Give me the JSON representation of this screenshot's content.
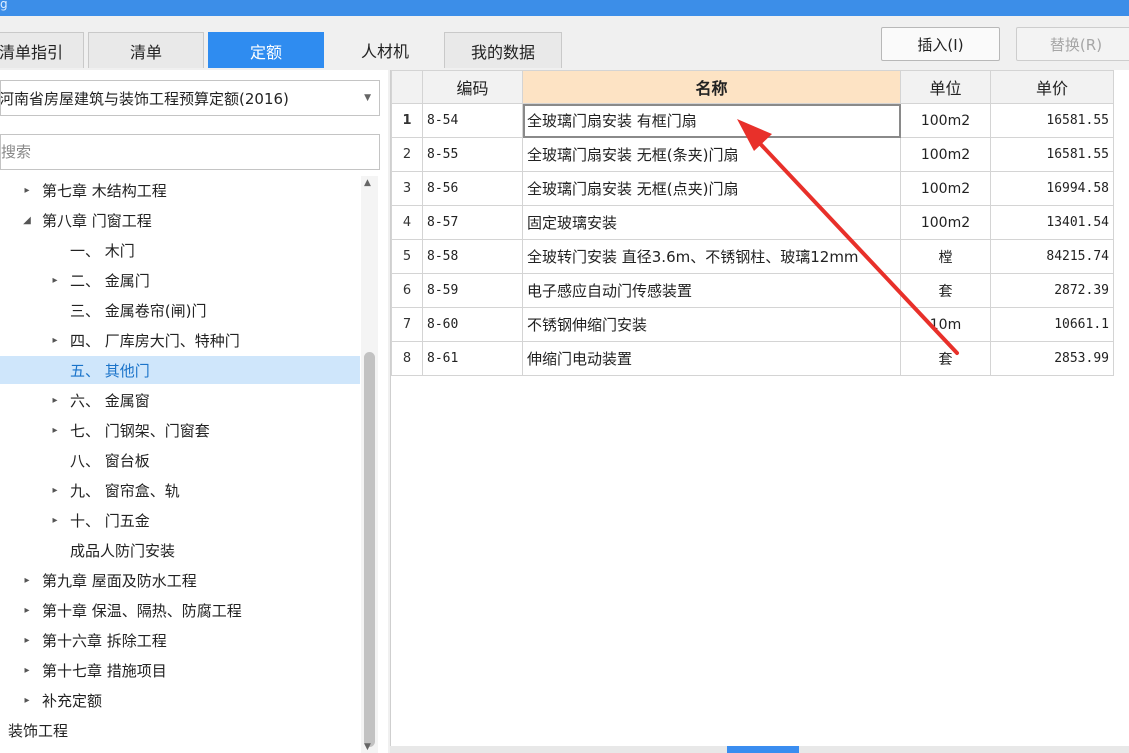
{
  "window": {
    "title_fragment": "g"
  },
  "tabs": [
    {
      "label": "清单指引",
      "active": false
    },
    {
      "label": "清单",
      "active": false
    },
    {
      "label": "定额",
      "active": true
    },
    {
      "label": "人材机",
      "active": false
    },
    {
      "label": "我的数据",
      "active": false
    }
  ],
  "toolbar": {
    "insert_label": "插入(I)",
    "replace_label": "替换(R)"
  },
  "left": {
    "quota_library": "河南省房屋建筑与装饰工程预算定额(2016)",
    "search_placeholder": "搜索",
    "tree": [
      {
        "label": "第七章 木结构工程",
        "toggle": "▸",
        "level": 1
      },
      {
        "label": "第八章 门窗工程",
        "toggle": "◢",
        "level": 1
      },
      {
        "label": "一、 木门",
        "toggle": "",
        "level": 2
      },
      {
        "label": "二、 金属门",
        "toggle": "▸",
        "level": 2
      },
      {
        "label": "三、 金属卷帘(闸)门",
        "toggle": "",
        "level": 2
      },
      {
        "label": "四、 厂库房大门、特种门",
        "toggle": "▸",
        "level": 2
      },
      {
        "label": "五、 其他门",
        "toggle": "",
        "level": 2,
        "selected": true
      },
      {
        "label": "六、 金属窗",
        "toggle": "▸",
        "level": 2
      },
      {
        "label": "七、 门钢架、门窗套",
        "toggle": "▸",
        "level": 2
      },
      {
        "label": "八、 窗台板",
        "toggle": "",
        "level": 2
      },
      {
        "label": "九、 窗帘盒、轨",
        "toggle": "▸",
        "level": 2
      },
      {
        "label": "十、 门五金",
        "toggle": "▸",
        "level": 2
      },
      {
        "label": "成品人防门安装",
        "toggle": "",
        "level": 2
      },
      {
        "label": "第九章 屋面及防水工程",
        "toggle": "▸",
        "level": 1
      },
      {
        "label": "第十章 保温、隔热、防腐工程",
        "toggle": "▸",
        "level": 1
      },
      {
        "label": "第十六章 拆除工程",
        "toggle": "▸",
        "level": 1
      },
      {
        "label": "第十七章 措施项目",
        "toggle": "▸",
        "level": 1
      },
      {
        "label": "补充定额",
        "toggle": "▸",
        "level": 1
      },
      {
        "label": "装饰工程",
        "toggle": "",
        "level": 0
      }
    ]
  },
  "grid": {
    "headers": {
      "code": "编码",
      "name": "名称",
      "unit": "单位",
      "price": "单价"
    },
    "rows": [
      {
        "num": "1",
        "code": "8-54",
        "name": "全玻璃门扇安装 有框门扇",
        "unit": "100m2",
        "price": "16581.55"
      },
      {
        "num": "2",
        "code": "8-55",
        "name": "全玻璃门扇安装 无框(条夹)门扇",
        "unit": "100m2",
        "price": "16581.55"
      },
      {
        "num": "3",
        "code": "8-56",
        "name": "全玻璃门扇安装 无框(点夹)门扇",
        "unit": "100m2",
        "price": "16994.58"
      },
      {
        "num": "4",
        "code": "8-57",
        "name": "固定玻璃安装",
        "unit": "100m2",
        "price": "13401.54"
      },
      {
        "num": "5",
        "code": "8-58",
        "name": "全玻转门安装 直径3.6m、不锈钢柱、玻璃12mm",
        "unit": "樘",
        "price": "84215.74"
      },
      {
        "num": "6",
        "code": "8-59",
        "name": "电子感应自动门传感装置",
        "unit": "套",
        "price": "2872.39"
      },
      {
        "num": "7",
        "code": "8-60",
        "name": "不锈钢伸缩门安装",
        "unit": "10m",
        "price": "10661.1"
      },
      {
        "num": "8",
        "code": "8-61",
        "name": "伸缩门电动装置",
        "unit": "套",
        "price": "2853.99"
      }
    ]
  },
  "colors": {
    "accent": "#2f8cf0",
    "annotation_arrow": "#e8302a",
    "header_highlight": "#fde3c4",
    "selection": "#cfe6fb"
  },
  "icons": {
    "dropdown": "chevron-down-icon",
    "expand": "triangle-right-icon",
    "collapse": "triangle-down-icon"
  }
}
